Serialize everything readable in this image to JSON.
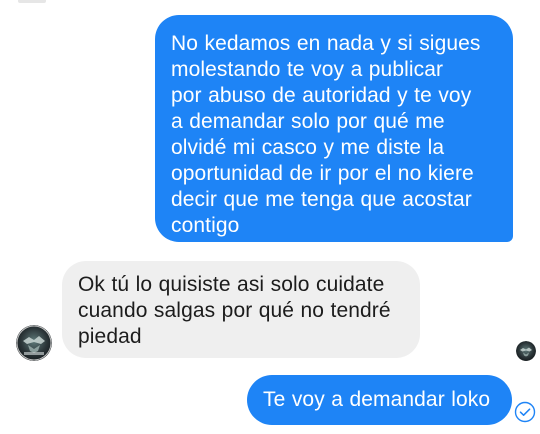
{
  "conversation": {
    "messages": [
      {
        "sender": "me",
        "text": "No kedamos en nada y si sigues\nmolestando te voy a publicar\npor abuso de autoridad y te voy\na demandar solo por qué me\nolvidé mi casco y me diste la\noportunidad de ir por el no kiere\ndecir que me tenga que acostar\ncontigo"
      },
      {
        "sender": "contact",
        "text": "Ok tú lo quisiste asi solo cuidate\ncuando salgas por qué no tendré\npiedad"
      },
      {
        "sender": "me",
        "text": "Te voy a demandar loko"
      }
    ],
    "contact_avatar_icon": "profile-avatar-icon",
    "read_receipt_icon": "seen-avatar-icon",
    "delivery_status_icon": "sent-check-icon"
  },
  "colors": {
    "outgoing_bubble": "#1e84f6",
    "incoming_bubble": "#efefef",
    "outgoing_text": "#ffffff",
    "incoming_text": "#1c1c1c",
    "status_check": "#1e84f6"
  }
}
